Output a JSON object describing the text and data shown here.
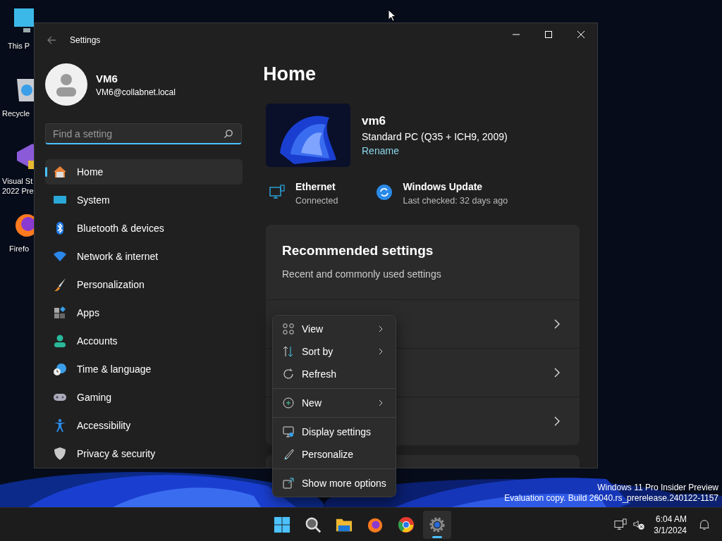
{
  "desktop_icons": [
    {
      "lines": [
        "This P"
      ]
    },
    {
      "lines": [
        "Recycle"
      ]
    },
    {
      "lines": [
        "Visual St",
        "2022 Pre"
      ]
    },
    {
      "lines": [
        "Firefo"
      ]
    }
  ],
  "window": {
    "title": "Settings"
  },
  "profile": {
    "name": "VM6",
    "email": "VM6@collabnet.local"
  },
  "search": {
    "placeholder": "Find a setting"
  },
  "nav": [
    {
      "label": "Home",
      "selected": true
    },
    {
      "label": "System",
      "selected": false
    },
    {
      "label": "Bluetooth & devices",
      "selected": false
    },
    {
      "label": "Network & internet",
      "selected": false
    },
    {
      "label": "Personalization",
      "selected": false
    },
    {
      "label": "Apps",
      "selected": false
    },
    {
      "label": "Accounts",
      "selected": false
    },
    {
      "label": "Time & language",
      "selected": false
    },
    {
      "label": "Gaming",
      "selected": false
    },
    {
      "label": "Accessibility",
      "selected": false
    },
    {
      "label": "Privacy & security",
      "selected": false
    }
  ],
  "page_title": "Home",
  "device": {
    "name": "vm6",
    "model": "Standard PC (Q35 + ICH9, 2009)",
    "rename": "Rename"
  },
  "status": [
    {
      "title": "Ethernet",
      "detail": "Connected"
    },
    {
      "title": "Windows Update",
      "detail": "Last checked: 32 days ago"
    }
  ],
  "recommended": {
    "title": "Recommended settings",
    "subtitle": "Recent and commonly used settings",
    "rows": [
      {
        "kind": "link"
      },
      {
        "kind": "link"
      },
      {
        "kind": "link"
      }
    ]
  },
  "context_menu": [
    {
      "kind": "item",
      "label": "View",
      "submenu": true
    },
    {
      "kind": "item",
      "label": "Sort by",
      "submenu": true
    },
    {
      "kind": "item",
      "label": "Refresh",
      "submenu": false
    },
    {
      "kind": "separator"
    },
    {
      "kind": "item",
      "label": "New",
      "submenu": true
    },
    {
      "kind": "separator"
    },
    {
      "kind": "item",
      "label": "Display settings",
      "submenu": false
    },
    {
      "kind": "item",
      "label": "Personalize",
      "submenu": false
    },
    {
      "kind": "separator"
    },
    {
      "kind": "item",
      "label": "Show more options",
      "submenu": false
    }
  ],
  "build_info": [
    "Windows 11 Pro Insider Preview",
    "Evaluation copy. Build 26040.rs_prerelease.240122-1157"
  ],
  "taskbar": {
    "apps": [
      {
        "selected": false
      },
      {
        "selected": false
      },
      {
        "selected": false
      },
      {
        "selected": false
      },
      {
        "selected": false
      },
      {
        "selected": true
      }
    ]
  },
  "clock": {
    "time": "6:04 AM",
    "date": "3/1/2024"
  }
}
